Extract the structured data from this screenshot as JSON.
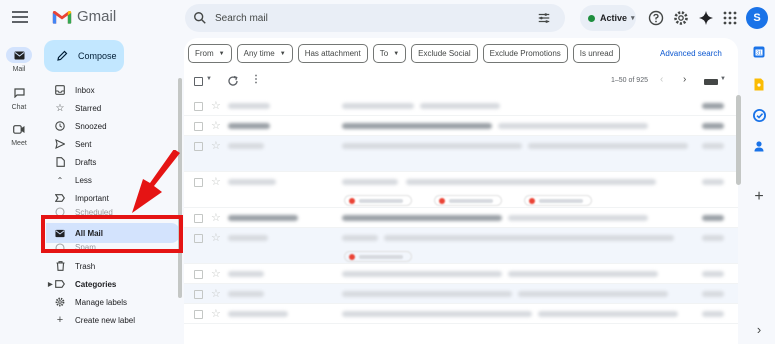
{
  "header": {
    "app_name": "Gmail",
    "search_placeholder": "Search mail",
    "status": "Active",
    "avatar_initial": "S"
  },
  "rail": {
    "items": [
      {
        "label": "Mail",
        "icon": "mail-icon",
        "active": true
      },
      {
        "label": "Chat",
        "icon": "chat-icon",
        "active": false
      },
      {
        "label": "Meet",
        "icon": "meet-icon",
        "active": false
      }
    ]
  },
  "sidebar": {
    "compose_label": "Compose",
    "items": [
      {
        "label": "Inbox",
        "icon": "inbox-icon"
      },
      {
        "label": "Starred",
        "icon": "star-icon"
      },
      {
        "label": "Snoozed",
        "icon": "clock-icon"
      },
      {
        "label": "Sent",
        "icon": "send-icon"
      },
      {
        "label": "Drafts",
        "icon": "draft-icon"
      },
      {
        "label": "Less",
        "icon": "chevron-up-icon"
      },
      {
        "label": "Important",
        "icon": "important-icon"
      },
      {
        "label": "Scheduled",
        "icon": "schedule-icon"
      },
      {
        "label": "All Mail",
        "icon": "all-mail-icon",
        "active": true
      },
      {
        "label": "Spam",
        "icon": "spam-icon"
      },
      {
        "label": "Trash",
        "icon": "trash-icon"
      },
      {
        "label": "Categories",
        "icon": "label-icon"
      },
      {
        "label": "Manage labels",
        "icon": "gear-icon"
      },
      {
        "label": "Create new label",
        "icon": "plus-icon"
      }
    ]
  },
  "filters": {
    "chips": [
      "From",
      "Any time",
      "Has attachment",
      "To",
      "Exclude Social",
      "Exclude Promotions",
      "Is unread"
    ],
    "advanced_search": "Advanced search"
  },
  "toolbar": {
    "pagination": "1–50 of 925"
  },
  "colors": {
    "accent": "#0b57d0",
    "compose_bg": "#c2e7ff",
    "selected_bg": "#d3e3fd",
    "annotation_red": "#e51414"
  }
}
